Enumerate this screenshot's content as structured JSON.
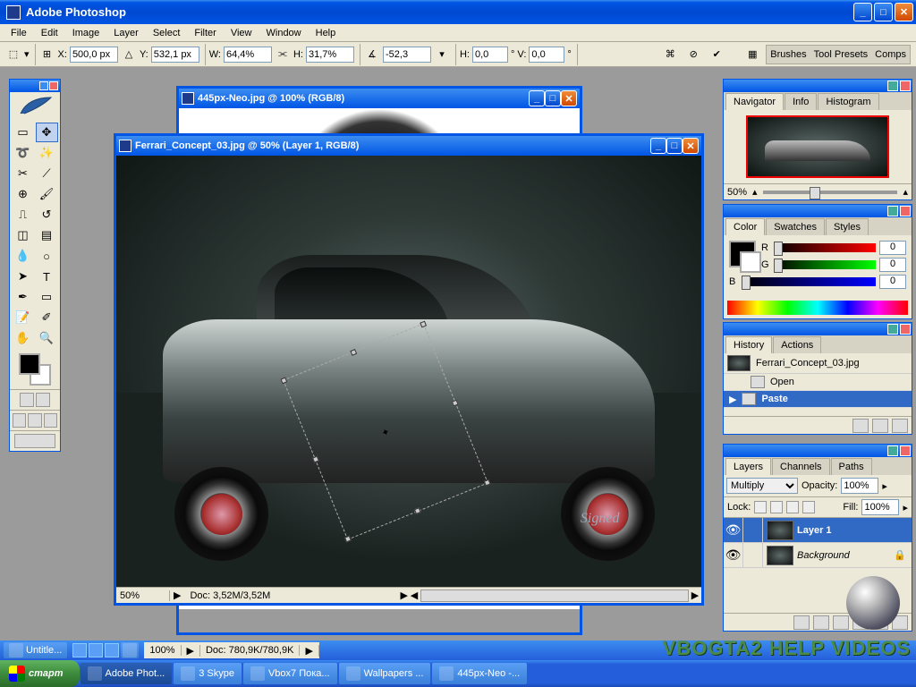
{
  "app": {
    "title": "Adobe Photoshop"
  },
  "menu": [
    "File",
    "Edit",
    "Image",
    "Layer",
    "Select",
    "Filter",
    "View",
    "Window",
    "Help"
  ],
  "options": {
    "x": "500,0 px",
    "y": "532,1 px",
    "w": "64,4%",
    "h": "31,7%",
    "angle": "-52,3",
    "hskew": "0,0",
    "vskew": "0,0"
  },
  "palette_tabs": {
    "right_strip": [
      "Brushes",
      "Tool Presets",
      "Comps"
    ]
  },
  "doc_back": {
    "title": "445px-Neo.jpg @ 100% (RGB/8)",
    "zoom": "100%",
    "info": "Doc: 780,9K/780,9K"
  },
  "doc_front": {
    "title": "Ferrari_Concept_03.jpg @ 50% (Layer 1, RGB/8)",
    "zoom": "50%",
    "info": "Doc: 3,52M/3,52M"
  },
  "navigator": {
    "tabs": [
      "Navigator",
      "Info",
      "Histogram"
    ],
    "zoom": "50%"
  },
  "color": {
    "tabs": [
      "Color",
      "Swatches",
      "Styles"
    ],
    "r": "0",
    "g": "0",
    "b": "0"
  },
  "history": {
    "tabs": [
      "History",
      "Actions"
    ],
    "source": "Ferrari_Concept_03.jpg",
    "items": [
      "Open",
      "Paste"
    ]
  },
  "layers": {
    "tabs": [
      "Layers",
      "Channels",
      "Paths"
    ],
    "blend": "Multiply",
    "opacity_label": "Opacity:",
    "opacity": "100%",
    "lock_label": "Lock:",
    "fill_label": "Fill:",
    "fill": "100%",
    "rows": [
      {
        "name": "Layer 1",
        "selected": true,
        "locked": false
      },
      {
        "name": "Background",
        "selected": false,
        "locked": true,
        "italic": true
      }
    ]
  },
  "secbar": {
    "item": "Untitle..."
  },
  "taskbar": {
    "start": "старт",
    "items": [
      "Adobe Phot...",
      "3 Skype",
      "Vbox7 Пока...",
      "Wallpapers ...",
      "445px-Neo -..."
    ]
  },
  "watermark": "VBOGTA2 HELP VIDEOS"
}
